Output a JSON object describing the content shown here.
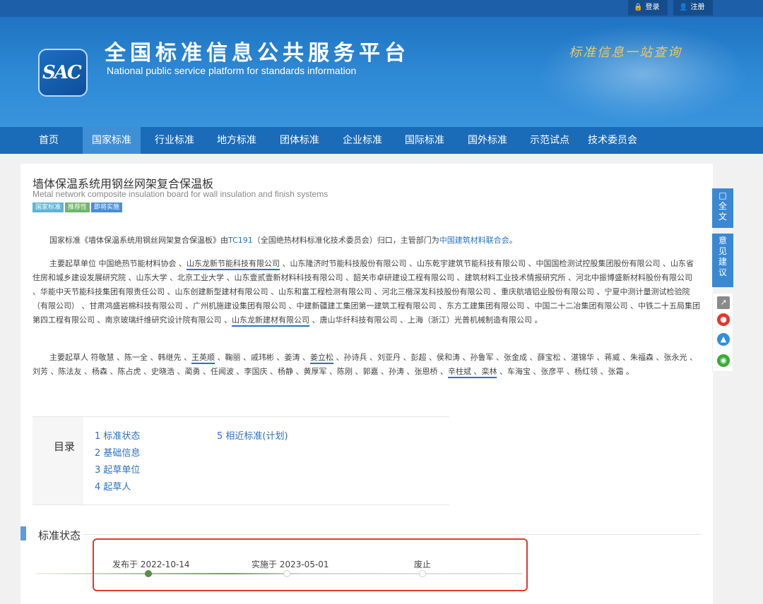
{
  "header": {
    "login_label": "登录",
    "register_label": "注册",
    "logo_text": "SAC",
    "site_title": "全国标准信息公共服务平台",
    "site_subtitle": "National public service platform  for standards information",
    "slogan": "标准信息一站查询"
  },
  "nav": {
    "items": [
      "首页",
      "国家标准",
      "行业标准",
      "地方标准",
      "团体标准",
      "企业标准",
      "国际标准",
      "国外标准",
      "示范试点",
      "技术委员会"
    ],
    "active": "国家标准"
  },
  "doc": {
    "title": "墙体保温系统用钢丝网架复合保温板",
    "subtitle": "Metal network composite insulation board for wall insulation and finish systems",
    "tags": [
      {
        "label": "国家标准",
        "color": "#5fb3d6"
      },
      {
        "label": "推荐性",
        "color": "#6fb56a"
      },
      {
        "label": "即将实施",
        "color": "#4a8ed6"
      }
    ]
  },
  "intro": {
    "t1": "国家标准《墙体保温系统用钢丝网架复合保温板》由",
    "tc": "TC191",
    "t2": "（全国绝热材料标准化技术委员会）归口，主管部门为",
    "dept": "中国建筑材料联合会",
    "t3": "。"
  },
  "units": {
    "prefix": "主要起草单位",
    "s1": " 中国绝热节能材料协会 、",
    "hl1": "山东龙新节能科技有限公司",
    "s2": " 、山东隆济时节能科技股份有限公司 、山东乾宇建筑节能科技有限公司 、中国国检测试控股集团股份有限公司 、山东省住房和城乡建设发展研究院 、山东大学 、北京工业大学 、山东壹贰壹新材料科技有限公司 、韶关市卓研建设工程有限公司 、建筑材料工业技术情报研究所 、河北中振博盛新材料股份有限公司 、华能中天节能科技集团有限责任公司 、山东创建新型建材有限公司 、山东和富工程检测有限公司 、河北三楷深发科技股份有限公司 、重庆航墙铝业股份有限公司 、宁夏中测计量测试检验院（有限公司） 、甘肃鸿盛岩棉科技有限公司 、广州机施建设集团有限公司 、中建新疆建工集团第一建筑工程有限公司 、东方工建集团有限公司 、中国二十二冶集团有限公司 、中铁二十五局集团第四工程有限公司 、南京玻璃纤维研究设计院有限公司 、",
    "hl2": "山东龙新建材有限公司",
    "s3": " 、唐山华纤科技有限公司 、上海（浙江）光普机械制造有限公司 。"
  },
  "drafters": {
    "prefix": "主要起草人",
    "s1": " 符敬慧 、陈一全 、韩继先 、",
    "hl1": "王英顺",
    "s2": " 、鞠丽 、戚玮彬 、姜涛 、",
    "hl2": "姜立松",
    "s3": " 、孙诗兵 、刘亚丹 、彭超 、侯和涛 、孙鲁军 、张金成 、薛宝松 、湛锦华 、蒋威 、朱福森 、张永光 、刘芳 、陈法友 、杨森 、陈占虎 、史晓浩 、蔺勇 、任闻波 、李国庆 、杨静 、黄厚军 、陈刚 、郭嘉 、孙涛 、张恩桥 、",
    "hl3": "辛柱斌",
    "s4": " 、",
    "hl4": "栾林",
    "s5": " 、车海宝 、张彦平 、杨红领 、张霜 。"
  },
  "toc": {
    "title": "目录",
    "items": [
      "1 标准状态",
      "2 基础信息",
      "3 起草单位",
      "4 起草人",
      "5 相近标准(计划)"
    ]
  },
  "status_section": {
    "title": "标准状态",
    "steps": [
      {
        "label": "发布于 2022-10-14",
        "done": true
      },
      {
        "label": "实施于 2023-05-01",
        "done": false
      },
      {
        "label": "废止",
        "done": false
      }
    ]
  },
  "side": {
    "fulltext": "全文",
    "feedback": "意见建议"
  }
}
